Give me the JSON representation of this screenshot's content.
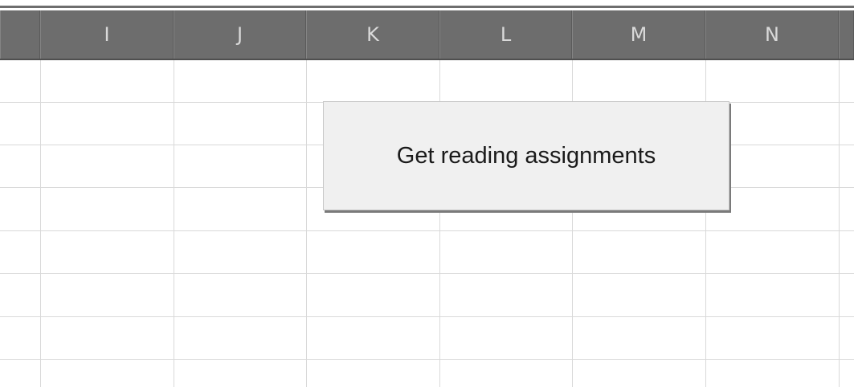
{
  "sheet": {
    "columns": [
      "I",
      "J",
      "K",
      "L",
      "M",
      "N"
    ]
  },
  "button": {
    "label": "Get reading assignments"
  },
  "colors": {
    "header_bg": "#6d6d6d",
    "header_text": "#d9d9d9",
    "gridline": "#d9d9d9",
    "button_bg": "#f0f0f0"
  }
}
